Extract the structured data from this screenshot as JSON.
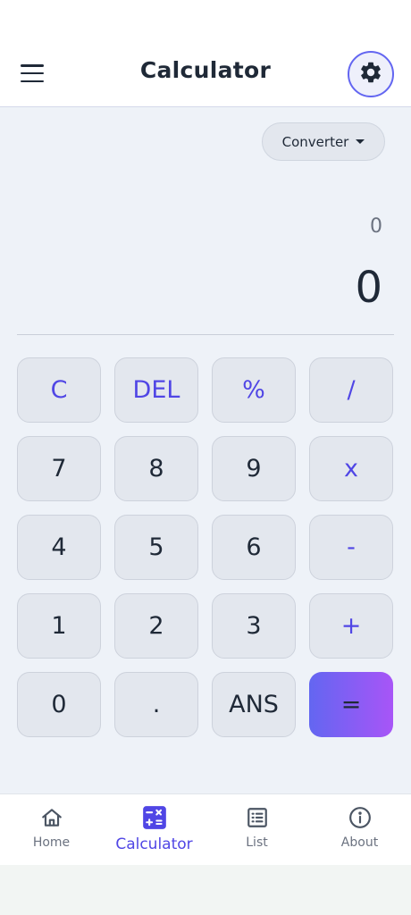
{
  "header": {
    "title": "Calculator",
    "menu_icon": "hamburger-menu-icon",
    "settings_icon": "gear-icon"
  },
  "converter": {
    "label": "Converter",
    "icon": "caret-down-icon"
  },
  "display": {
    "expression": "0",
    "result": "0"
  },
  "keypad": {
    "keys": [
      {
        "label": "C",
        "kind": "op",
        "name": "clear-key"
      },
      {
        "label": "DEL",
        "kind": "op",
        "name": "delete-key"
      },
      {
        "label": "%",
        "kind": "op",
        "name": "percent-key"
      },
      {
        "label": "/",
        "kind": "op",
        "name": "divide-key"
      },
      {
        "label": "7",
        "kind": "num",
        "name": "digit-7-key"
      },
      {
        "label": "8",
        "kind": "num",
        "name": "digit-8-key"
      },
      {
        "label": "9",
        "kind": "num",
        "name": "digit-9-key"
      },
      {
        "label": "x",
        "kind": "op",
        "name": "multiply-key"
      },
      {
        "label": "4",
        "kind": "num",
        "name": "digit-4-key"
      },
      {
        "label": "5",
        "kind": "num",
        "name": "digit-5-key"
      },
      {
        "label": "6",
        "kind": "num",
        "name": "digit-6-key"
      },
      {
        "label": "-",
        "kind": "op",
        "name": "subtract-key"
      },
      {
        "label": "1",
        "kind": "num",
        "name": "digit-1-key"
      },
      {
        "label": "2",
        "kind": "num",
        "name": "digit-2-key"
      },
      {
        "label": "3",
        "kind": "num",
        "name": "digit-3-key"
      },
      {
        "label": "+",
        "kind": "op",
        "name": "add-key"
      },
      {
        "label": "0",
        "kind": "num",
        "name": "digit-0-key"
      },
      {
        "label": ".",
        "kind": "num",
        "name": "decimal-key"
      },
      {
        "label": "ANS",
        "kind": "num",
        "name": "answer-key"
      },
      {
        "label": "=",
        "kind": "eq",
        "name": "equals-key"
      }
    ]
  },
  "nav": {
    "items": [
      {
        "label": "Home",
        "icon": "home-icon"
      },
      {
        "label": "Calculator",
        "icon": "calculator-icon",
        "active": true
      },
      {
        "label": "List",
        "icon": "list-icon"
      },
      {
        "label": "About",
        "icon": "info-icon"
      }
    ]
  },
  "colors": {
    "accent": "#5046e5",
    "gradient_start": "#6366f1",
    "gradient_end": "#a855f7"
  }
}
